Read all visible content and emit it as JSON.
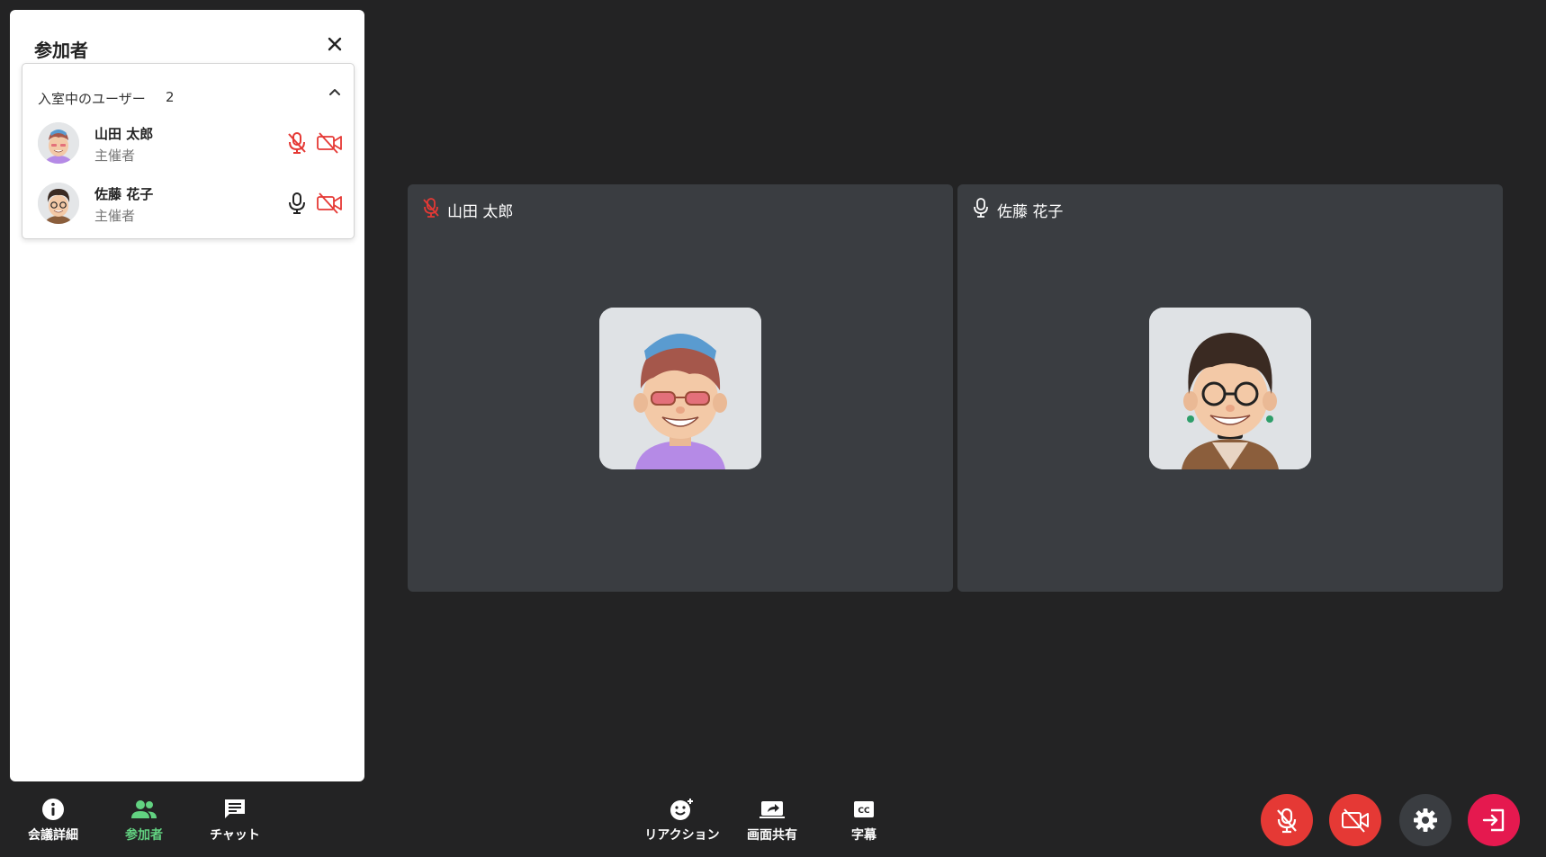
{
  "panel": {
    "title": "参加者",
    "group": {
      "label": "入室中のユーザー",
      "count": "2"
    },
    "participants": [
      {
        "name": "山田 太郎",
        "role": "主催者",
        "mic": "muted",
        "camera": "off"
      },
      {
        "name": "佐藤 花子",
        "role": "主催者",
        "mic": "on",
        "camera": "off"
      }
    ]
  },
  "tiles": [
    {
      "name": "山田 太郎",
      "mic": "muted"
    },
    {
      "name": "佐藤 花子",
      "mic": "on"
    }
  ],
  "bottom_left": {
    "meeting_details": "会議詳細",
    "participants": "参加者",
    "chat": "チャット"
  },
  "bottom_center": {
    "reaction": "リアクション",
    "screen_share": "画面共有",
    "captions": "字幕"
  },
  "controls": [
    "mic-off-button",
    "camera-off-button",
    "settings-button",
    "leave-button"
  ],
  "colors": {
    "background": "#232324",
    "tile": "#3a3d41",
    "muted_red": "#e53935",
    "leave_pink": "#e5194f",
    "active_green": "#62d281",
    "settings_gray": "#3a3d41"
  }
}
